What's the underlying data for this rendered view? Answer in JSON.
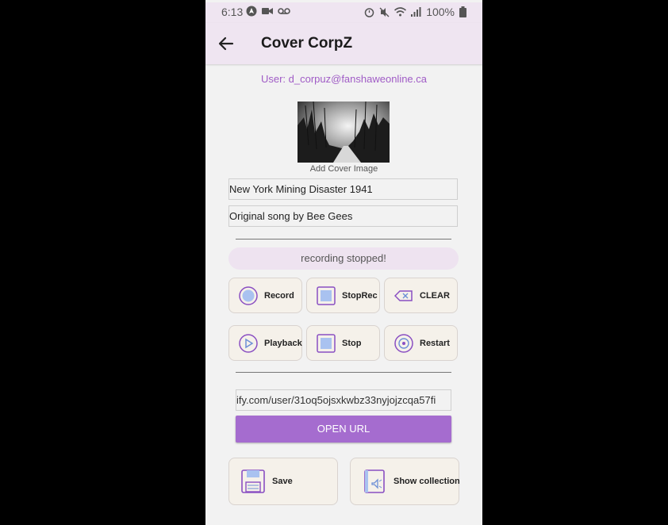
{
  "status_bar": {
    "time": "6:13",
    "battery": "100%"
  },
  "app_bar": {
    "title": "Cover CorpZ"
  },
  "user_label": "User: d_corpuz@fanshaweonline.ca",
  "cover": {
    "caption": "Add Cover Image"
  },
  "fields": {
    "song_title": "New York Mining Disaster 1941",
    "description": "Original song by Bee Gees"
  },
  "recording_status": "recording stopped!",
  "controls": {
    "record": "Record",
    "stop_rec": "StopRec",
    "clear": "CLEAR",
    "playback": "Playback",
    "stop": "Stop",
    "restart": "Restart"
  },
  "url": {
    "value": "ify.com/user/31oq5ojsxkwbz33nyjojzcqa57fi",
    "button": "OPEN URL"
  },
  "actions": {
    "save": "Save",
    "show_collection": "Show collection"
  },
  "colors": {
    "accent": "#a56ccf",
    "app_bar": "#efe5f1",
    "user_text": "#a05cc6"
  }
}
